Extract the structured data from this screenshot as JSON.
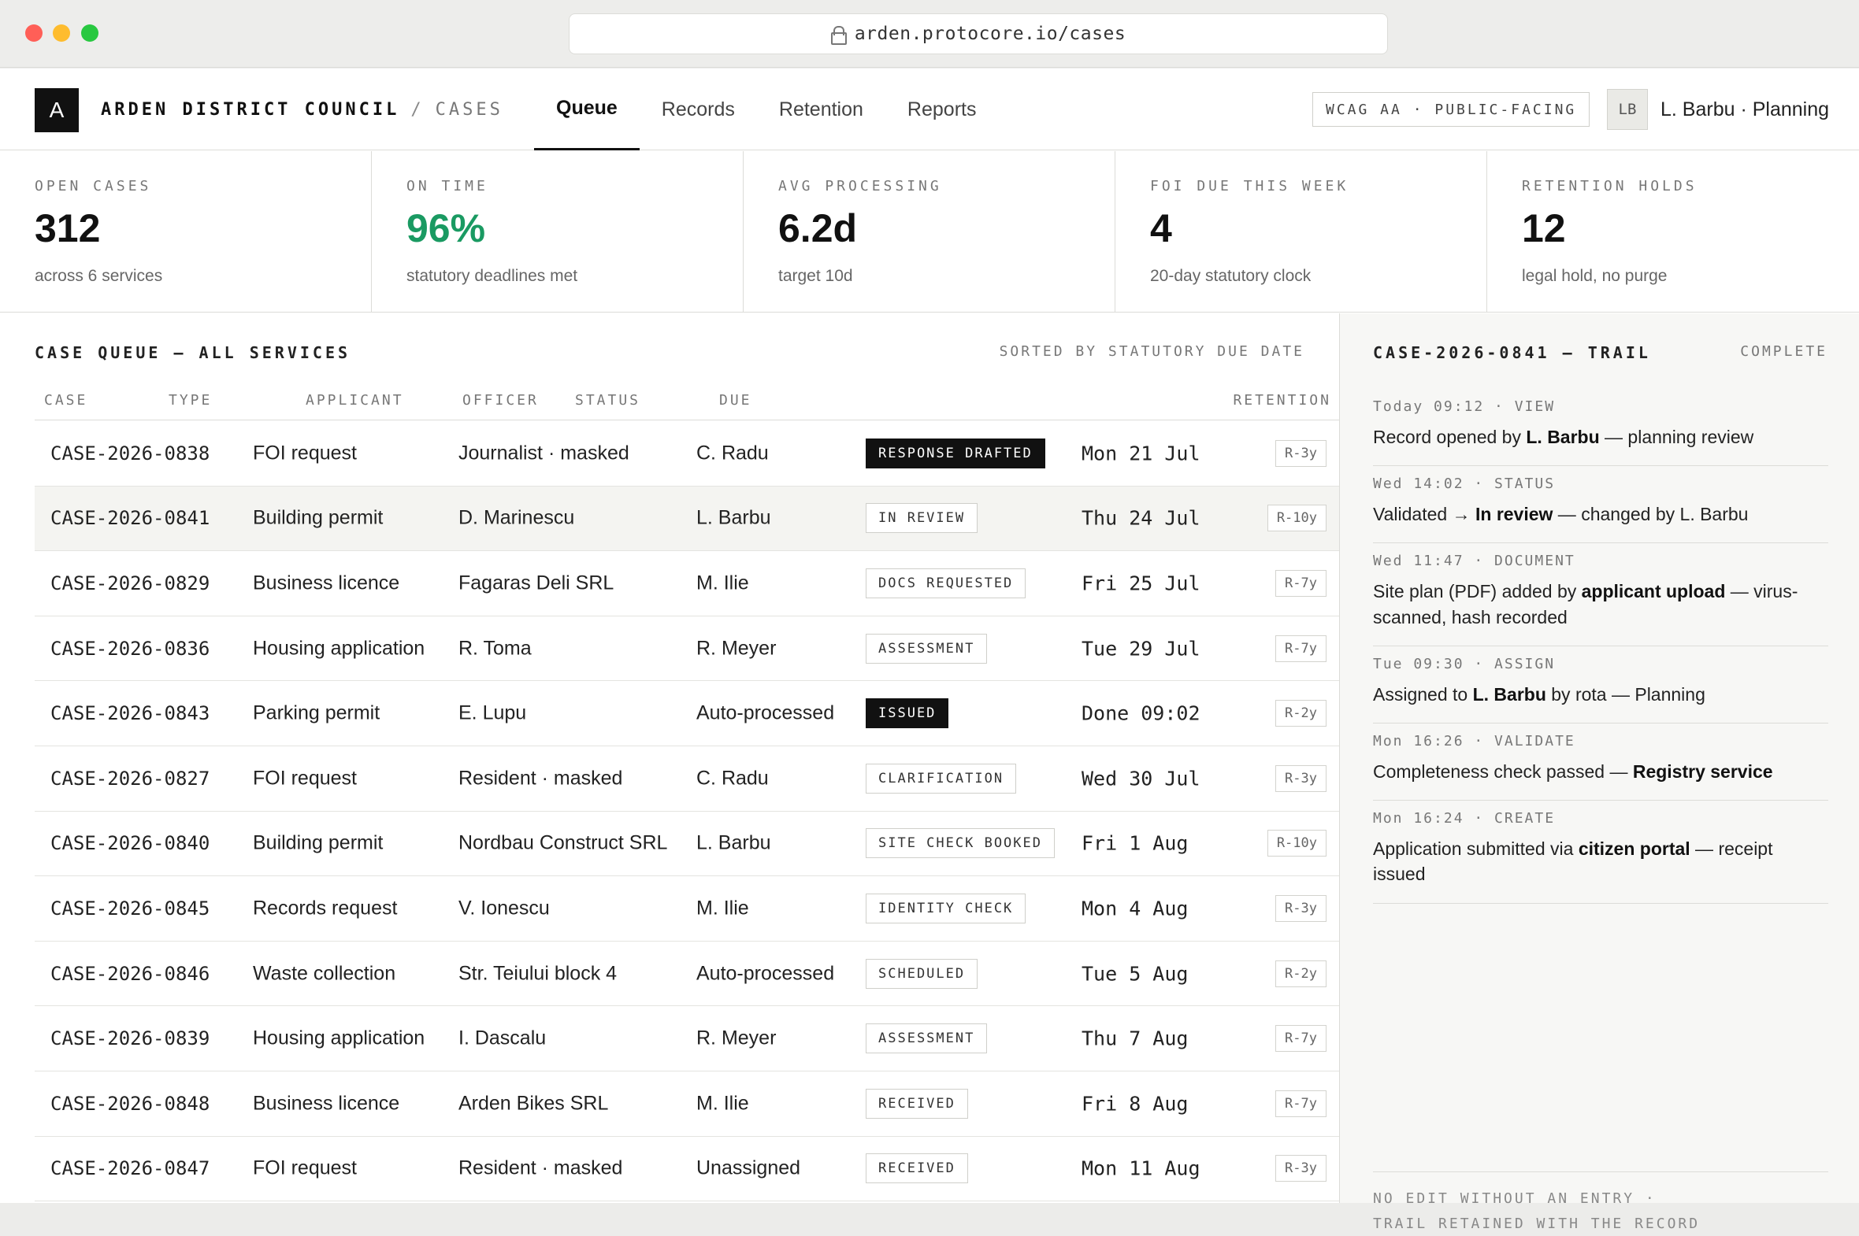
{
  "browser": {
    "url": "arden.protocore.io/cases"
  },
  "header": {
    "logo_letter": "A",
    "org": "ARDEN DISTRICT COUNCIL",
    "separator": "/",
    "section": "CASES",
    "tabs": [
      {
        "label": "Queue",
        "active": true
      },
      {
        "label": "Records",
        "active": false
      },
      {
        "label": "Retention",
        "active": false
      },
      {
        "label": "Reports",
        "active": false
      }
    ],
    "accessibility_tag": "WCAG AA · PUBLIC-FACING",
    "avatar_initials": "LB",
    "user_label": "L. Barbu · Planning"
  },
  "stats": [
    {
      "label": "OPEN CASES",
      "value": "312",
      "sub": "across 6 services",
      "accent": ""
    },
    {
      "label": "ON TIME",
      "value": "96%",
      "sub": "statutory deadlines met",
      "accent": "#1a9a62"
    },
    {
      "label": "AVG PROCESSING",
      "value": "6.2d",
      "sub": "target 10d",
      "accent": ""
    },
    {
      "label": "FOI DUE THIS WEEK",
      "value": "4",
      "sub": "20-day statutory clock",
      "accent": ""
    },
    {
      "label": "RETENTION HOLDS",
      "value": "12",
      "sub": "legal hold, no purge",
      "accent": ""
    }
  ],
  "queue": {
    "title": "CASE QUEUE — ALL SERVICES",
    "sort_label": "SORTED BY STATUTORY DUE DATE",
    "columns": [
      "CASE",
      "TYPE",
      "APPLICANT",
      "OFFICER",
      "STATUS",
      "DUE",
      "RETENTION"
    ],
    "rows": [
      {
        "case": "CASE-2026-0838",
        "type": "FOI request",
        "applicant": "Journalist · masked",
        "officer": "C. Radu",
        "status": "RESPONSE DRAFTED",
        "status_style": "dark",
        "due": "Mon 21 Jul",
        "retention": "R-3y",
        "selected": false
      },
      {
        "case": "CASE-2026-0841",
        "type": "Building permit",
        "applicant": "D. Marinescu",
        "officer": "L. Barbu",
        "status": "IN REVIEW",
        "status_style": "outline",
        "due": "Thu 24 Jul",
        "retention": "R-10y",
        "selected": true
      },
      {
        "case": "CASE-2026-0829",
        "type": "Business licence",
        "applicant": "Fagaras Deli SRL",
        "officer": "M. Ilie",
        "status": "DOCS REQUESTED",
        "status_style": "outline",
        "due": "Fri 25 Jul",
        "retention": "R-7y",
        "selected": false
      },
      {
        "case": "CASE-2026-0836",
        "type": "Housing application",
        "applicant": "R. Toma",
        "officer": "R. Meyer",
        "status": "ASSESSMENT",
        "status_style": "outline",
        "due": "Tue 29 Jul",
        "retention": "R-7y",
        "selected": false
      },
      {
        "case": "CASE-2026-0843",
        "type": "Parking permit",
        "applicant": "E. Lupu",
        "officer": "Auto-processed",
        "status": "ISSUED",
        "status_style": "dark",
        "due": "Done 09:02",
        "retention": "R-2y",
        "selected": false
      },
      {
        "case": "CASE-2026-0827",
        "type": "FOI request",
        "applicant": "Resident · masked",
        "officer": "C. Radu",
        "status": "CLARIFICATION",
        "status_style": "outline",
        "due": "Wed 30 Jul",
        "retention": "R-3y",
        "selected": false
      },
      {
        "case": "CASE-2026-0840",
        "type": "Building permit",
        "applicant": "Nordbau Construct SRL",
        "officer": "L. Barbu",
        "status": "SITE CHECK BOOKED",
        "status_style": "outline",
        "due": "Fri 1 Aug",
        "retention": "R-10y",
        "selected": false
      },
      {
        "case": "CASE-2026-0845",
        "type": "Records request",
        "applicant": "V. Ionescu",
        "officer": "M. Ilie",
        "status": "IDENTITY CHECK",
        "status_style": "outline",
        "due": "Mon 4 Aug",
        "retention": "R-3y",
        "selected": false
      },
      {
        "case": "CASE-2026-0846",
        "type": "Waste collection",
        "applicant": "Str. Teiului block 4",
        "officer": "Auto-processed",
        "status": "SCHEDULED",
        "status_style": "outline",
        "due": "Tue 5 Aug",
        "retention": "R-2y",
        "selected": false
      },
      {
        "case": "CASE-2026-0839",
        "type": "Housing application",
        "applicant": "I. Dascalu",
        "officer": "R. Meyer",
        "status": "ASSESSMENT",
        "status_style": "outline",
        "due": "Thu 7 Aug",
        "retention": "R-7y",
        "selected": false
      },
      {
        "case": "CASE-2026-0848",
        "type": "Business licence",
        "applicant": "Arden Bikes SRL",
        "officer": "M. Ilie",
        "status": "RECEIVED",
        "status_style": "outline",
        "due": "Fri 8 Aug",
        "retention": "R-7y",
        "selected": false
      },
      {
        "case": "CASE-2026-0847",
        "type": "FOI request",
        "applicant": "Resident · masked",
        "officer": "Unassigned",
        "status": "RECEIVED",
        "status_style": "outline",
        "due": "Mon 11 Aug",
        "retention": "R-3y",
        "selected": false
      }
    ]
  },
  "trail": {
    "title": "CASE-2026-0841 — TRAIL",
    "status": "COMPLETE",
    "events": [
      {
        "meta": "Today 09:12 · VIEW",
        "parts": [
          {
            "t": "Record opened by "
          },
          {
            "t": "L. Barbu",
            "b": true
          },
          {
            "t": " — planning review"
          }
        ]
      },
      {
        "meta": "Wed 14:02 · STATUS",
        "parts": [
          {
            "t": "Validated → "
          },
          {
            "t": "In review",
            "b": true
          },
          {
            "t": " — changed by L. Barbu"
          }
        ]
      },
      {
        "meta": "Wed 11:47 · DOCUMENT",
        "parts": [
          {
            "t": "Site plan (PDF) added by "
          },
          {
            "t": "applicant upload",
            "b": true
          },
          {
            "t": " — virus-scanned, hash recorded"
          }
        ]
      },
      {
        "meta": "Tue 09:30 · ASSIGN",
        "parts": [
          {
            "t": "Assigned to "
          },
          {
            "t": "L. Barbu",
            "b": true
          },
          {
            "t": " by rota — Planning"
          }
        ]
      },
      {
        "meta": "Mon 16:26 · VALIDATE",
        "parts": [
          {
            "t": "Completeness check passed — "
          },
          {
            "t": "Registry service",
            "b": true
          }
        ]
      },
      {
        "meta": "Mon 16:24 · CREATE",
        "parts": [
          {
            "t": "Application submitted via "
          },
          {
            "t": "citizen portal",
            "b": true
          },
          {
            "t": " — receipt issued"
          }
        ]
      }
    ],
    "footnote_line1": "NO EDIT WITHOUT AN ENTRY ·",
    "footnote_line2": "TRAIL RETAINED WITH THE RECORD"
  }
}
